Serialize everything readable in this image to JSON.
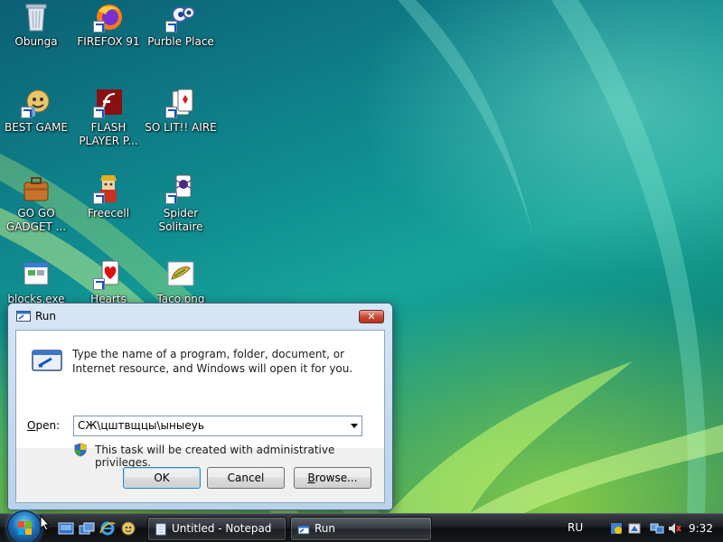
{
  "desktop": {
    "icons": [
      {
        "label": "Obunga",
        "icon": "recycle-bin-icon"
      },
      {
        "label": "FIREFOX 91",
        "icon": "firefox-icon"
      },
      {
        "label": "Purble Place",
        "icon": "purble-place-icon"
      },
      {
        "label": "BEST GAME",
        "icon": "game-icon"
      },
      {
        "label": "FLASH PLAYER P...",
        "icon": "flash-player-icon"
      },
      {
        "label": "SO LIT!! AIRE",
        "icon": "solitaire-icon"
      },
      {
        "label": "GO GO GADGET ...",
        "icon": "briefcase-icon"
      },
      {
        "label": "Freecell",
        "icon": "freecell-icon"
      },
      {
        "label": "Spider Solitaire",
        "icon": "spider-solitaire-icon"
      },
      {
        "label": "blocks.exe",
        "icon": "exe-icon"
      },
      {
        "label": "Hearts",
        "icon": "hearts-icon"
      },
      {
        "label": "Taco.png",
        "icon": "image-file-icon"
      }
    ]
  },
  "run_dialog": {
    "title": "Run",
    "close_label": "✕",
    "description": "Type the name of a program, folder, document, or Internet resource, and Windows will open it for you.",
    "open_label_prefix": "",
    "open_label_underlined": "O",
    "open_label_rest": "pen:",
    "open_value": "СЖ\\цштвщцы\\ыныеуь",
    "admin_note": "This task will be created with administrative privileges.",
    "ok_label": "OK",
    "cancel_label": "Cancel",
    "browse_label_underlined": "B",
    "browse_label_rest": "rowse..."
  },
  "taskbar": {
    "tasks": [
      {
        "label": "Untitled - Notepad",
        "icon": "notepad-icon"
      },
      {
        "label": "Run",
        "icon": "run-icon"
      }
    ],
    "language": "RU",
    "clock": "9:32"
  },
  "colors": {
    "accent": "#1a4fc6",
    "close_button": "#c6462f",
    "taskbar": "#1c1f23"
  }
}
